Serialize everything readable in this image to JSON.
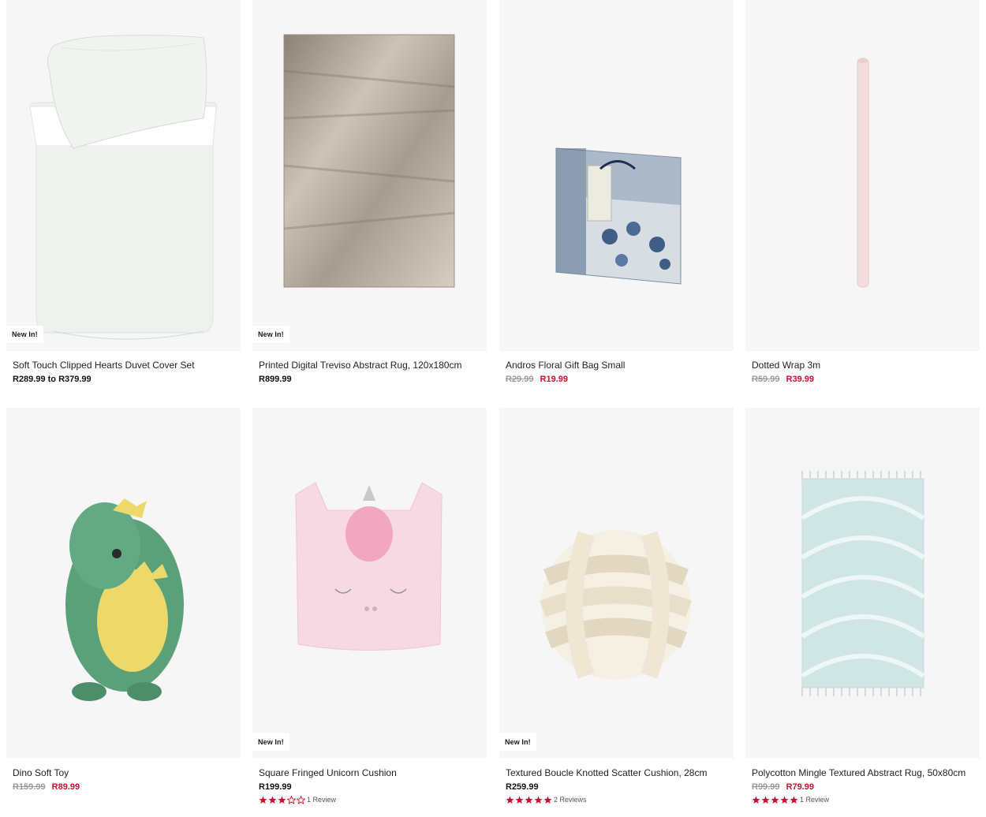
{
  "products": [
    {
      "title": "Soft Touch Clipped Hearts Duvet Cover Set",
      "badge": "New In!",
      "price": "R289.99 to R379.99",
      "was": "",
      "now": ""
    },
    {
      "title": "Printed Digital Treviso Abstract Rug, 120x180cm",
      "badge": "New In!",
      "price": "R899.99",
      "was": "",
      "now": ""
    },
    {
      "title": "Andros Floral Gift Bag Small",
      "badge": "",
      "price": "",
      "was": "R29.99",
      "now": "R19.99"
    },
    {
      "title": "Dotted Wrap 3m",
      "badge": "",
      "price": "",
      "was": "R59.99",
      "now": "R39.99"
    },
    {
      "title": "Dino Soft Toy",
      "badge": "",
      "price": "",
      "was": "R159.99",
      "now": "R89.99"
    },
    {
      "title": "Square Fringed Unicorn Cushion",
      "badge": "New In!",
      "price": "R199.99",
      "was": "",
      "now": "",
      "rating": 3,
      "reviews": "1 Review"
    },
    {
      "title": "Textured Boucle Knotted Scatter Cushion, 28cm",
      "badge": "New In!",
      "price": "R259.99",
      "was": "",
      "now": "",
      "rating": 5,
      "reviews": "2 Reviews"
    },
    {
      "title": "Polycotton Mingle Textured Abstract Rug, 50x80cm",
      "badge": "",
      "price": "",
      "was": "R99.99",
      "now": "R79.99",
      "rating": 5,
      "reviews": "1 Review"
    }
  ],
  "colors": {
    "sale": "#c8102e",
    "star": "#c8102e",
    "media_bg": "#f6f6f6"
  }
}
